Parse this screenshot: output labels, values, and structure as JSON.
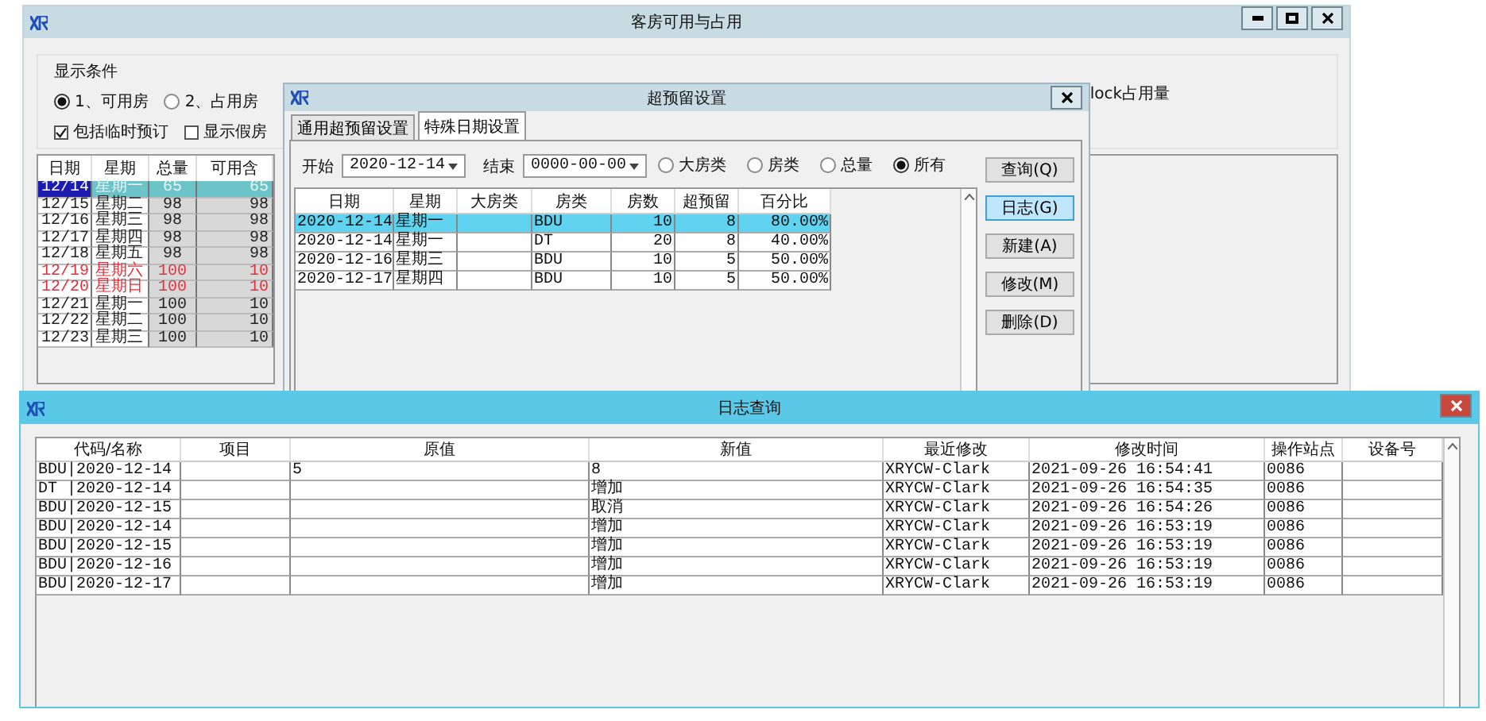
{
  "main_window": {
    "title": "客房可用与占用",
    "group_title": "显示条件",
    "radios": [
      {
        "label": "1、可用房",
        "selected": true
      },
      {
        "label": "2、占用房",
        "selected": false
      }
    ],
    "checkboxes": [
      {
        "label": "包括临时预订",
        "checked": true
      },
      {
        "label": "显示假房",
        "checked": false
      }
    ],
    "side_label": "lock占用量",
    "table": {
      "columns": [
        "日期",
        "星期",
        "总量",
        "可用含"
      ],
      "rows": [
        {
          "cells": [
            "12/14",
            "星期一",
            "65",
            "65"
          ],
          "selected": true,
          "weekend": false
        },
        {
          "cells": [
            "12/15",
            "星期二",
            "98",
            "98"
          ],
          "selected": false,
          "weekend": false
        },
        {
          "cells": [
            "12/16",
            "星期三",
            "98",
            "98"
          ],
          "selected": false,
          "weekend": false
        },
        {
          "cells": [
            "12/17",
            "星期四",
            "98",
            "98"
          ],
          "selected": false,
          "weekend": false
        },
        {
          "cells": [
            "12/18",
            "星期五",
            "98",
            "98"
          ],
          "selected": false,
          "weekend": false
        },
        {
          "cells": [
            "12/19",
            "星期六",
            "100",
            "10"
          ],
          "selected": false,
          "weekend": true
        },
        {
          "cells": [
            "12/20",
            "星期日",
            "100",
            "10"
          ],
          "selected": false,
          "weekend": true
        },
        {
          "cells": [
            "12/21",
            "星期一",
            "100",
            "10"
          ],
          "selected": false,
          "weekend": false
        },
        {
          "cells": [
            "12/22",
            "星期二",
            "100",
            "10"
          ],
          "selected": false,
          "weekend": false
        },
        {
          "cells": [
            "12/23",
            "星期三",
            "100",
            "10"
          ],
          "selected": false,
          "weekend": false
        }
      ]
    }
  },
  "dialog": {
    "title": "超预留设置",
    "tabs": [
      {
        "label": "通用超预留设置",
        "selected": false
      },
      {
        "label": "特殊日期设置",
        "selected": true
      }
    ],
    "start_label": "开始",
    "start_value": "2020-12-14",
    "end_label": "结束",
    "end_value": "0000-00-00",
    "scope_options": [
      {
        "label": "大房类",
        "selected": false
      },
      {
        "label": "房类",
        "selected": false
      },
      {
        "label": "总量",
        "selected": false
      },
      {
        "label": "所有",
        "selected": true
      }
    ],
    "table": {
      "columns": [
        "日期",
        "星期",
        "大房类",
        "房类",
        "房数",
        "超预留",
        "百分比"
      ],
      "rows": [
        {
          "cells": [
            "2020-12-14",
            "星期一",
            "",
            "BDU",
            "10",
            "8",
            "80.00%"
          ],
          "selected": true
        },
        {
          "cells": [
            "2020-12-14",
            "星期一",
            "",
            "DT",
            "20",
            "8",
            "40.00%"
          ],
          "selected": false
        },
        {
          "cells": [
            "2020-12-16",
            "星期三",
            "",
            "BDU",
            "10",
            "5",
            "50.00%"
          ],
          "selected": false
        },
        {
          "cells": [
            "2020-12-17",
            "星期四",
            "",
            "BDU",
            "10",
            "5",
            "50.00%"
          ],
          "selected": false
        }
      ]
    },
    "buttons": [
      {
        "label": "查询(Q)",
        "focused": false
      },
      {
        "label": "日志(G)",
        "focused": true
      },
      {
        "label": "新建(A)",
        "focused": false
      },
      {
        "label": "修改(M)",
        "focused": false
      },
      {
        "label": "删除(D)",
        "focused": false
      }
    ]
  },
  "log_window": {
    "title": "日志查询",
    "columns": [
      "代码/名称",
      "项目",
      "原值",
      "新值",
      "最近修改",
      "修改时间",
      "操作站点",
      "设备号"
    ],
    "rows": [
      {
        "code_name": "BDU|2020-12-14",
        "original": "5",
        "new": "8",
        "modified_by": "XRYCW-Clark",
        "modified_time": "2021-09-26 16:54:41",
        "station": "0086"
      },
      {
        "code_name": "DT |2020-12-14",
        "new": "增加",
        "modified_by": "XRYCW-Clark",
        "modified_time": "2021-09-26 16:54:35",
        "station": "0086"
      },
      {
        "code_name": "BDU|2020-12-15",
        "new": "取消",
        "modified_by": "XRYCW-Clark",
        "modified_time": "2021-09-26 16:54:26",
        "station": "0086"
      },
      {
        "code_name": "BDU|2020-12-14",
        "new": "增加",
        "modified_by": "XRYCW-Clark",
        "modified_time": "2021-09-26 16:53:19",
        "station": "0086"
      },
      {
        "code_name": "BDU|2020-12-15",
        "new": "增加",
        "modified_by": "XRYCW-Clark",
        "modified_time": "2021-09-26 16:53:19",
        "station": "0086"
      },
      {
        "code_name": "BDU|2020-12-16",
        "new": "增加",
        "modified_by": "XRYCW-Clark",
        "modified_time": "2021-09-26 16:53:19",
        "station": "0086"
      },
      {
        "code_name": "BDU|2020-12-17",
        "new": "增加",
        "modified_by": "XRYCW-Clark",
        "modified_time": "2021-09-26 16:53:19",
        "station": "0086"
      }
    ]
  }
}
